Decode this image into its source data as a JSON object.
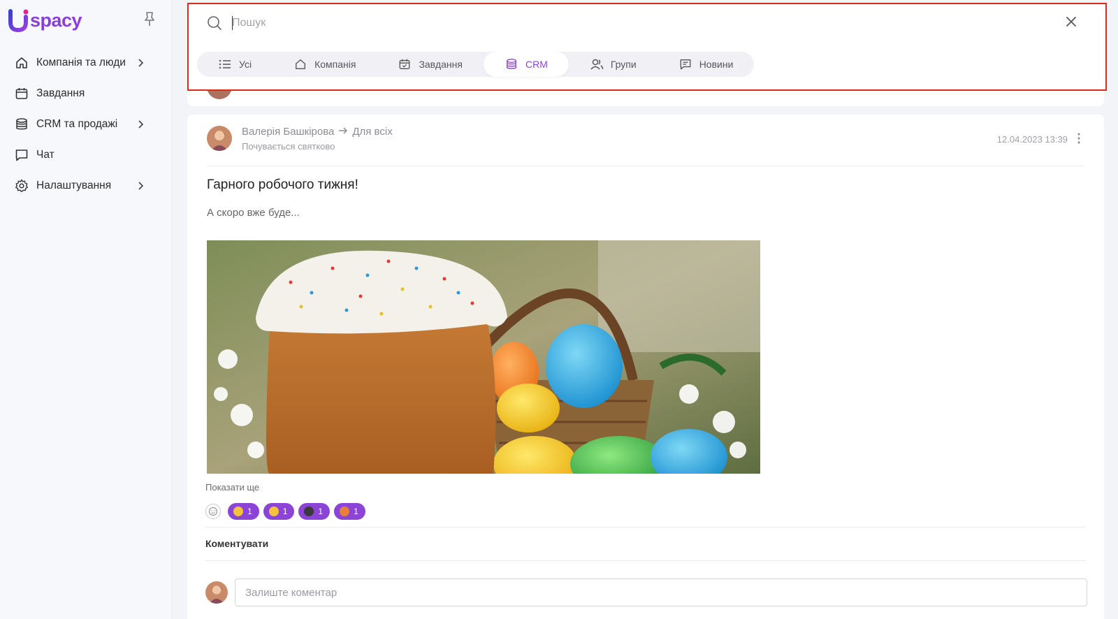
{
  "app": {
    "logo_text": "spacy",
    "brand_color": "#8b44d6"
  },
  "sidebar": {
    "items": [
      {
        "label": "Компанія та люди",
        "icon": "home-icon",
        "has_submenu": true
      },
      {
        "label": "Завдання",
        "icon": "calendar-icon",
        "has_submenu": false
      },
      {
        "label": "CRM та продажі",
        "icon": "database-icon",
        "has_submenu": true
      },
      {
        "label": "Чат",
        "icon": "chat-icon",
        "has_submenu": false
      },
      {
        "label": "Налаштування",
        "icon": "gear-icon",
        "has_submenu": true
      }
    ]
  },
  "search": {
    "placeholder": "Пошук",
    "value": "",
    "tabs": [
      {
        "label": "Усі",
        "icon": "list-icon",
        "active": false
      },
      {
        "label": "Компанія",
        "icon": "home-icon",
        "active": false
      },
      {
        "label": "Завдання",
        "icon": "calendar-icon",
        "active": false
      },
      {
        "label": "CRM",
        "icon": "database-icon",
        "active": true
      },
      {
        "label": "Групи",
        "icon": "users-icon",
        "active": false
      },
      {
        "label": "Новини",
        "icon": "news-icon",
        "active": false
      }
    ]
  },
  "post": {
    "author": "Валерія Башкірова",
    "audience": "Для всіх",
    "mood": "Почувається святково",
    "date": "12.04.2023 13:39",
    "title": "Гарного робочого тижня!",
    "text": "А скоро вже буде...",
    "show_more": "Показати ще",
    "reactions": [
      {
        "emoji": "grinning-face",
        "count": "1"
      },
      {
        "emoji": "kissing-face",
        "count": "1"
      },
      {
        "emoji": "sunglasses-face",
        "count": "1"
      },
      {
        "emoji": "party-face",
        "count": "1"
      }
    ],
    "comment_label": "Коментувати",
    "comment_placeholder": "Залиште коментар"
  }
}
